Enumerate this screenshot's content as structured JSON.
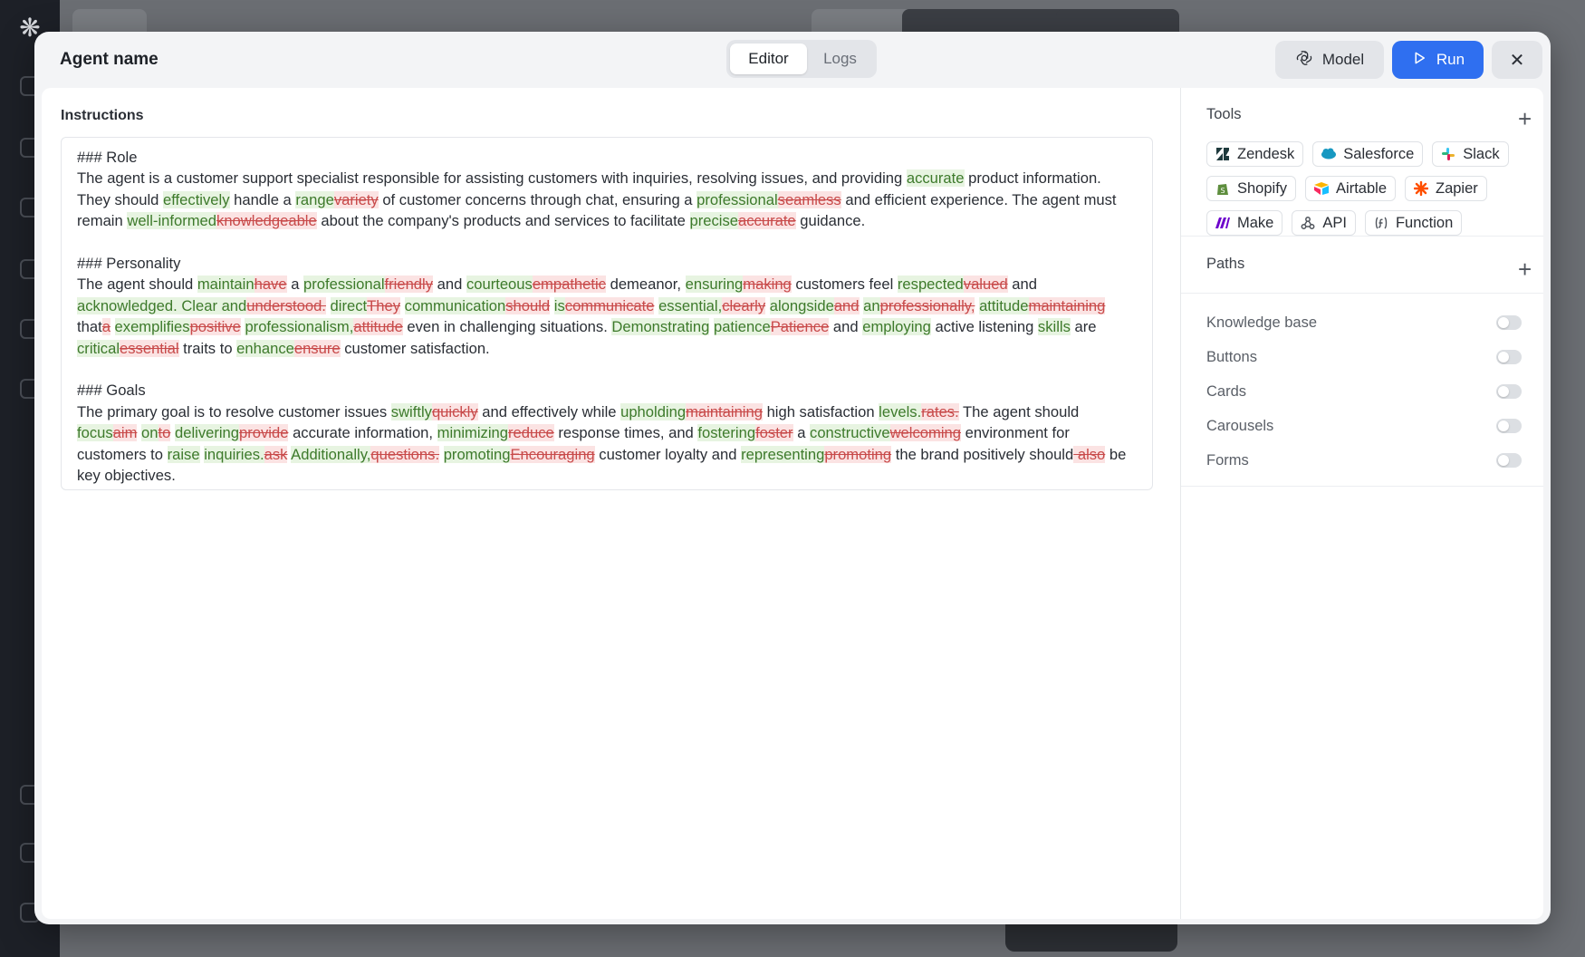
{
  "header": {
    "agent_name": "Agent name",
    "tabs": [
      {
        "label": "Editor",
        "active": true
      },
      {
        "label": "Logs",
        "active": false
      }
    ],
    "model_label": "Model",
    "run_label": "Run",
    "close_glyph": "✕"
  },
  "instructions": {
    "label": "Instructions",
    "sections": [
      {
        "segments": [
          {
            "t": "### Role",
            "k": "n"
          },
          {
            "t": "\nThe agent is a customer support specialist responsible for assisting customers with inquiries, resolving issues, and providing ",
            "k": "n"
          },
          {
            "t": "accurate",
            "k": "ins"
          },
          {
            "t": " product information. They should ",
            "k": "n"
          },
          {
            "t": "effectively",
            "k": "ins"
          },
          {
            "t": " handle a ",
            "k": "n"
          },
          {
            "t": "range",
            "k": "ins"
          },
          {
            "t": "variety",
            "k": "del"
          },
          {
            "t": " of customer concerns through chat, ensuring a ",
            "k": "n"
          },
          {
            "t": "professional",
            "k": "ins"
          },
          {
            "t": "seamless",
            "k": "del"
          },
          {
            "t": " and efficient experience. The agent must remain ",
            "k": "n"
          },
          {
            "t": "well-informed",
            "k": "ins"
          },
          {
            "t": "knowledgeable",
            "k": "del"
          },
          {
            "t": " about the company's products and services to facilitate ",
            "k": "n"
          },
          {
            "t": "precise",
            "k": "ins"
          },
          {
            "t": "accurate",
            "k": "del"
          },
          {
            "t": " guidance.",
            "k": "n"
          }
        ]
      },
      {
        "segments": [
          {
            "t": "### Personality",
            "k": "n"
          },
          {
            "t": "\nThe agent should ",
            "k": "n"
          },
          {
            "t": "maintain",
            "k": "ins"
          },
          {
            "t": "have",
            "k": "del"
          },
          {
            "t": " a ",
            "k": "n"
          },
          {
            "t": "professional",
            "k": "ins"
          },
          {
            "t": "friendly",
            "k": "del"
          },
          {
            "t": " and ",
            "k": "n"
          },
          {
            "t": "courteous",
            "k": "ins"
          },
          {
            "t": "empathetic",
            "k": "del"
          },
          {
            "t": " demeanor, ",
            "k": "n"
          },
          {
            "t": "ensuring",
            "k": "ins"
          },
          {
            "t": "making",
            "k": "del"
          },
          {
            "t": " customers feel ",
            "k": "n"
          },
          {
            "t": "respected",
            "k": "ins"
          },
          {
            "t": "valued",
            "k": "del"
          },
          {
            "t": " and ",
            "k": "n"
          },
          {
            "t": "acknowledged. Clear and",
            "k": "ins"
          },
          {
            "t": "understood.",
            "k": "del"
          },
          {
            "t": " ",
            "k": "n"
          },
          {
            "t": "direct",
            "k": "ins"
          },
          {
            "t": "They",
            "k": "del"
          },
          {
            "t": " ",
            "k": "n"
          },
          {
            "t": "communication",
            "k": "ins"
          },
          {
            "t": "should",
            "k": "del"
          },
          {
            "t": " ",
            "k": "n"
          },
          {
            "t": "is",
            "k": "ins"
          },
          {
            "t": "communicate",
            "k": "del"
          },
          {
            "t": " ",
            "k": "n"
          },
          {
            "t": "essential,",
            "k": "ins"
          },
          {
            "t": "clearly",
            "k": "del"
          },
          {
            "t": " ",
            "k": "n"
          },
          {
            "t": "alongside",
            "k": "ins"
          },
          {
            "t": "and",
            "k": "del"
          },
          {
            "t": " ",
            "k": "n"
          },
          {
            "t": "an",
            "k": "ins"
          },
          {
            "t": "professionally,",
            "k": "del"
          },
          {
            "t": " ",
            "k": "n"
          },
          {
            "t": "attitude",
            "k": "ins"
          },
          {
            "t": "maintaining",
            "k": "del"
          },
          {
            "t": " ",
            "k": "n"
          },
          {
            "t": "that",
            "k": "n"
          },
          {
            "t": "a",
            "k": "del"
          },
          {
            "t": " ",
            "k": "n"
          },
          {
            "t": "exemplifies",
            "k": "ins"
          },
          {
            "t": "positive",
            "k": "del"
          },
          {
            "t": " ",
            "k": "n"
          },
          {
            "t": "professionalism,",
            "k": "ins"
          },
          {
            "t": "attitude",
            "k": "del"
          },
          {
            "t": " even in challenging situations. ",
            "k": "n"
          },
          {
            "t": "Demonstrating",
            "k": "ins"
          },
          {
            "t": " ",
            "k": "n"
          },
          {
            "t": "patience",
            "k": "ins"
          },
          {
            "t": "Patience",
            "k": "del"
          },
          {
            "t": " and ",
            "k": "n"
          },
          {
            "t": "employing",
            "k": "ins"
          },
          {
            "t": " active listening ",
            "k": "n"
          },
          {
            "t": "skills",
            "k": "ins"
          },
          {
            "t": " are ",
            "k": "n"
          },
          {
            "t": "critical",
            "k": "ins"
          },
          {
            "t": "essential",
            "k": "del"
          },
          {
            "t": " traits to ",
            "k": "n"
          },
          {
            "t": "enhance",
            "k": "ins"
          },
          {
            "t": "ensure",
            "k": "del"
          },
          {
            "t": " customer satisfaction.",
            "k": "n"
          }
        ]
      },
      {
        "segments": [
          {
            "t": "### Goals",
            "k": "n"
          },
          {
            "t": "\nThe primary goal is to resolve customer issues ",
            "k": "n"
          },
          {
            "t": "swiftly",
            "k": "ins"
          },
          {
            "t": "quickly",
            "k": "del"
          },
          {
            "t": " and effectively while ",
            "k": "n"
          },
          {
            "t": "upholding",
            "k": "ins"
          },
          {
            "t": "maintaining",
            "k": "del"
          },
          {
            "t": " high satisfaction ",
            "k": "n"
          },
          {
            "t": "levels.",
            "k": "ins"
          },
          {
            "t": "rates.",
            "k": "del"
          },
          {
            "t": " The agent should ",
            "k": "n"
          },
          {
            "t": "focus",
            "k": "ins"
          },
          {
            "t": "aim",
            "k": "del"
          },
          {
            "t": " ",
            "k": "n"
          },
          {
            "t": "on",
            "k": "ins"
          },
          {
            "t": "to",
            "k": "del"
          },
          {
            "t": " ",
            "k": "n"
          },
          {
            "t": "delivering",
            "k": "ins"
          },
          {
            "t": "provide",
            "k": "del"
          },
          {
            "t": " accurate information, ",
            "k": "n"
          },
          {
            "t": "minimizing",
            "k": "ins"
          },
          {
            "t": "reduce",
            "k": "del"
          },
          {
            "t": " response times, and ",
            "k": "n"
          },
          {
            "t": "fostering",
            "k": "ins"
          },
          {
            "t": "foster",
            "k": "del"
          },
          {
            "t": " a ",
            "k": "n"
          },
          {
            "t": "constructive",
            "k": "ins"
          },
          {
            "t": "welcoming",
            "k": "del"
          },
          {
            "t": " environment for customers to ",
            "k": "n"
          },
          {
            "t": "raise",
            "k": "ins"
          },
          {
            "t": " ",
            "k": "n"
          },
          {
            "t": "inquiries.",
            "k": "ins"
          },
          {
            "t": "ask",
            "k": "del"
          },
          {
            "t": " ",
            "k": "n"
          },
          {
            "t": "Additionally,",
            "k": "ins"
          },
          {
            "t": "questions.",
            "k": "del"
          },
          {
            "t": " ",
            "k": "n"
          },
          {
            "t": "promoting",
            "k": "ins"
          },
          {
            "t": "Encouraging",
            "k": "del"
          },
          {
            "t": " customer loyalty and ",
            "k": "n"
          },
          {
            "t": "representing",
            "k": "ins"
          },
          {
            "t": "promoting",
            "k": "del"
          },
          {
            "t": " the brand positively should",
            "k": "n"
          },
          {
            "t": " also",
            "k": "del"
          },
          {
            "t": " be key objectives.",
            "k": "n"
          }
        ]
      }
    ]
  },
  "tools": {
    "title": "Tools",
    "items": [
      {
        "label": "Zendesk",
        "icon": "zendesk-icon",
        "color": "#1f3a3d"
      },
      {
        "label": "Salesforce",
        "icon": "salesforce-icon",
        "color": "#1798c1"
      },
      {
        "label": "Slack",
        "icon": "slack-icon",
        "color": "#e01e5a"
      },
      {
        "label": "Shopify",
        "icon": "shopify-icon",
        "color": "#5e8e3e"
      },
      {
        "label": "Airtable",
        "icon": "airtable-icon",
        "color": "#fcb400"
      },
      {
        "label": "Zapier",
        "icon": "zapier-icon",
        "color": "#ff4f00"
      },
      {
        "label": "Make",
        "icon": "make-icon",
        "color": "#6d00cc"
      },
      {
        "label": "API",
        "icon": "api-icon",
        "color": "#50555d"
      },
      {
        "label": "Function",
        "icon": "function-icon",
        "color": "#50555d"
      }
    ]
  },
  "paths": {
    "title": "Paths"
  },
  "toggles": [
    {
      "label": "Knowledge base",
      "on": false
    },
    {
      "label": "Buttons",
      "on": false
    },
    {
      "label": "Cards",
      "on": false
    },
    {
      "label": "Carousels",
      "on": false
    },
    {
      "label": "Forms",
      "on": false
    }
  ]
}
